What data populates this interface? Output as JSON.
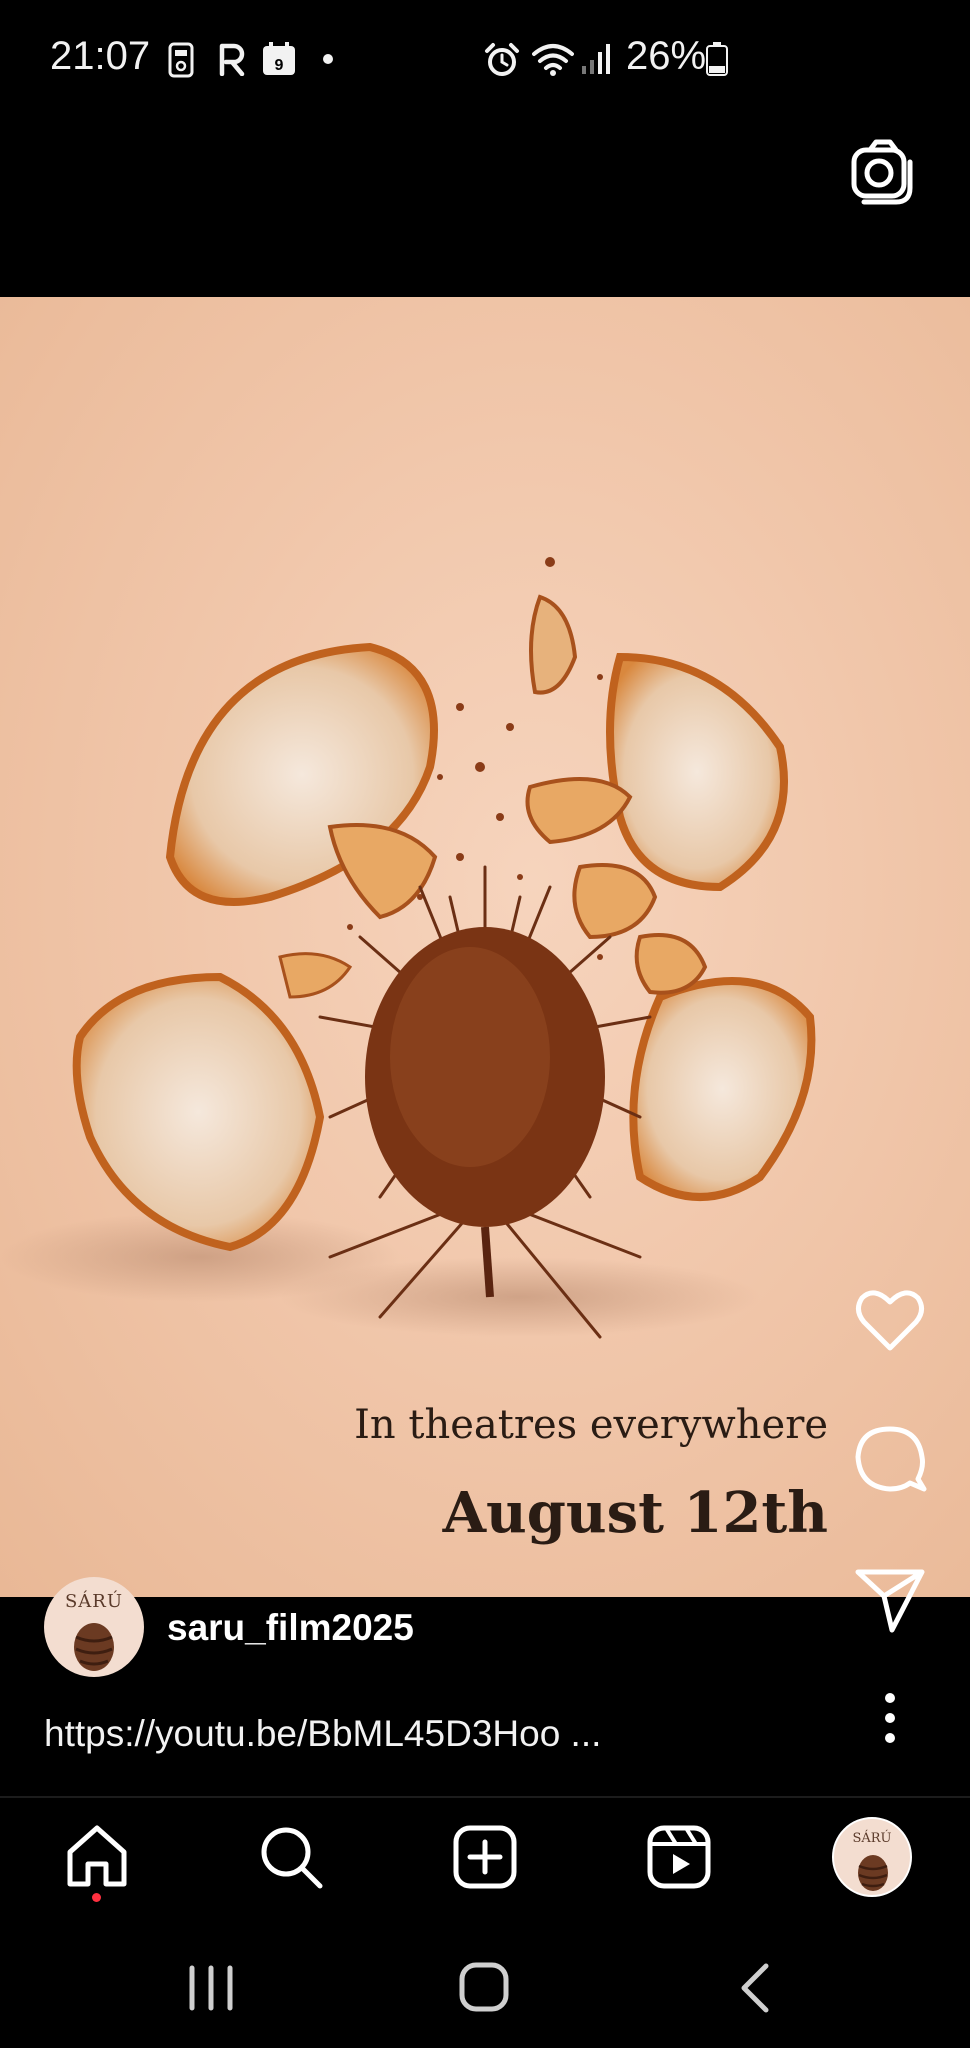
{
  "status_bar": {
    "time": "21:07",
    "battery": "26%",
    "calendar_day": "9",
    "icons": [
      "phone-manager-icon",
      "r-app-icon",
      "calendar-icon",
      "notification-dot-icon",
      "alarm-icon",
      "wifi-icon",
      "signal-icon",
      "battery-icon"
    ]
  },
  "post": {
    "caption_line1": "In theatres everywhere",
    "caption_line2": "August 12th",
    "avatar_brand": "SÁRÚ",
    "username": "saru_film2025",
    "link": "https://youtu.be/BbML45D3Hoo ..."
  },
  "actions": [
    "like-icon",
    "comment-icon",
    "share-icon",
    "more-icon"
  ],
  "bottom_nav": {
    "items": [
      "home-icon",
      "search-icon",
      "create-icon",
      "reels-icon",
      "profile-avatar"
    ],
    "profile_brand": "SÁRÚ"
  },
  "system_nav": [
    "recents-icon",
    "home-icon",
    "back-icon"
  ],
  "colors": {
    "background": "#000000",
    "media_bg": "#f1c7ab",
    "text": "#ffffff",
    "notification_dot": "#ff3040"
  }
}
